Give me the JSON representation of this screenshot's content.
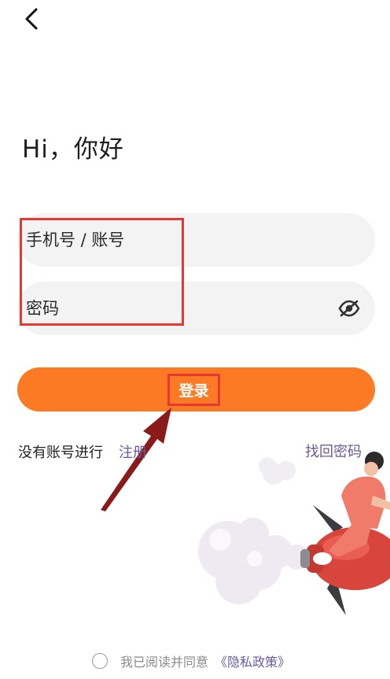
{
  "header": {
    "back_icon": "chevron-left-icon"
  },
  "greeting": "Hi，你好",
  "form": {
    "account_placeholder": "手机号 / 账号",
    "password_placeholder": "密码",
    "password_toggle_icon": "eye-hidden-icon",
    "login_label": "登录"
  },
  "links": {
    "no_account_text": "没有账号进行",
    "register_label": "注册",
    "forgot_password_label": "找回密码"
  },
  "privacy": {
    "agree_text": "我已阅读并同意",
    "policy_link": "《隐私政策》"
  },
  "colors": {
    "accent": "#fb7a23",
    "link": "#6a5aa0",
    "annotation_red": "#e53935",
    "annotation_arrow": "#8b1a1a"
  }
}
